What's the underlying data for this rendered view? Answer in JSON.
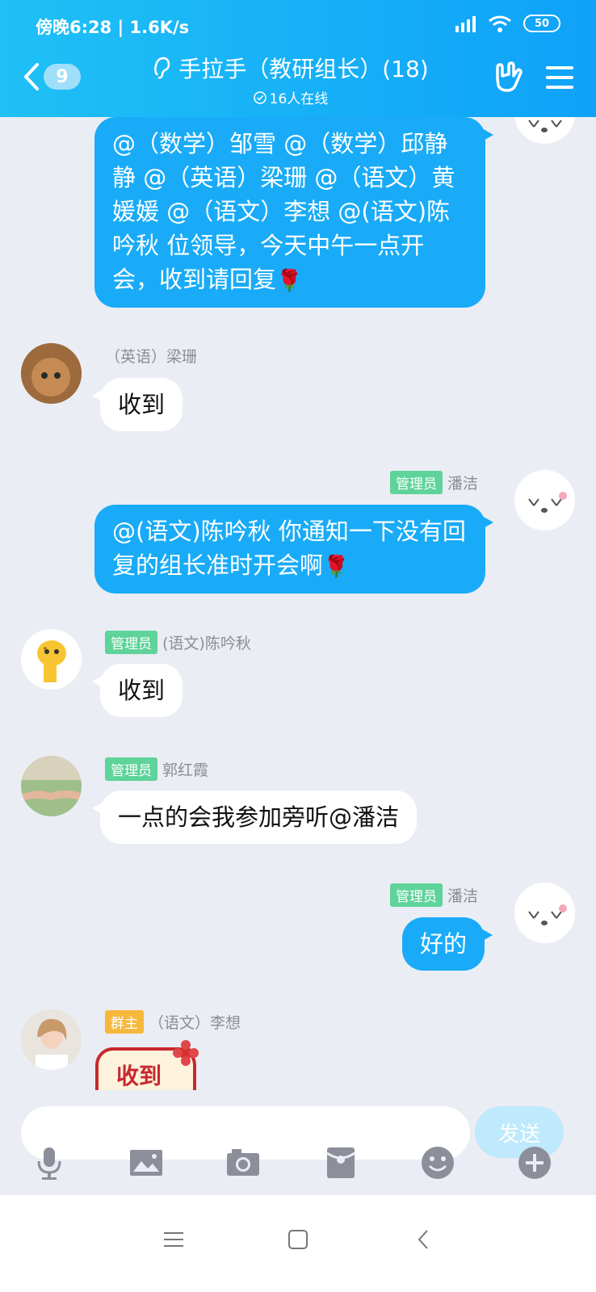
{
  "status": {
    "time": "傍晚6:28 | 1.6K/s",
    "battery": "50"
  },
  "header": {
    "unread": "9",
    "title": "手拉手（教研组长）(18)",
    "online": "16人在线"
  },
  "messages": [
    {
      "text": "@（数学）邹雪 @（数学）邱静静 @（英语）梁珊 @（语文）黄媛媛 @（语文）李想 @(语文)陈吟秋 位领导，今天中午一点开会，收到请回复"
    },
    {
      "nick": "（英语）梁珊",
      "text": "收到"
    },
    {
      "tag": "管理员",
      "nick": "潘洁",
      "text": "@(语文)陈吟秋 你通知一下没有回复的组长准时开会啊"
    },
    {
      "tag": "管理员",
      "nick": "(语文)陈吟秋",
      "text": "收到"
    },
    {
      "tag": "管理员",
      "nick": "郭红霞",
      "text": "一点的会我参加旁听@潘洁"
    },
    {
      "tag": "管理员",
      "nick": "潘洁",
      "text": "好的"
    },
    {
      "tag": "群主",
      "nick": "（语文）李想",
      "text": "收到"
    }
  ],
  "composer": {
    "placeholder": "",
    "send": "发送"
  },
  "toolbar": [
    "mic-icon",
    "image-icon",
    "camera-icon",
    "red-packet-icon",
    "emoji-icon",
    "plus-icon"
  ],
  "colors": {
    "header_start": "#1fc0f6",
    "header_end": "#0fa2f8",
    "bubble_out": "#19abf7",
    "admin_tag": "#5ed39a",
    "owner_tag": "#f6b83b",
    "background": "#eaedf4"
  }
}
